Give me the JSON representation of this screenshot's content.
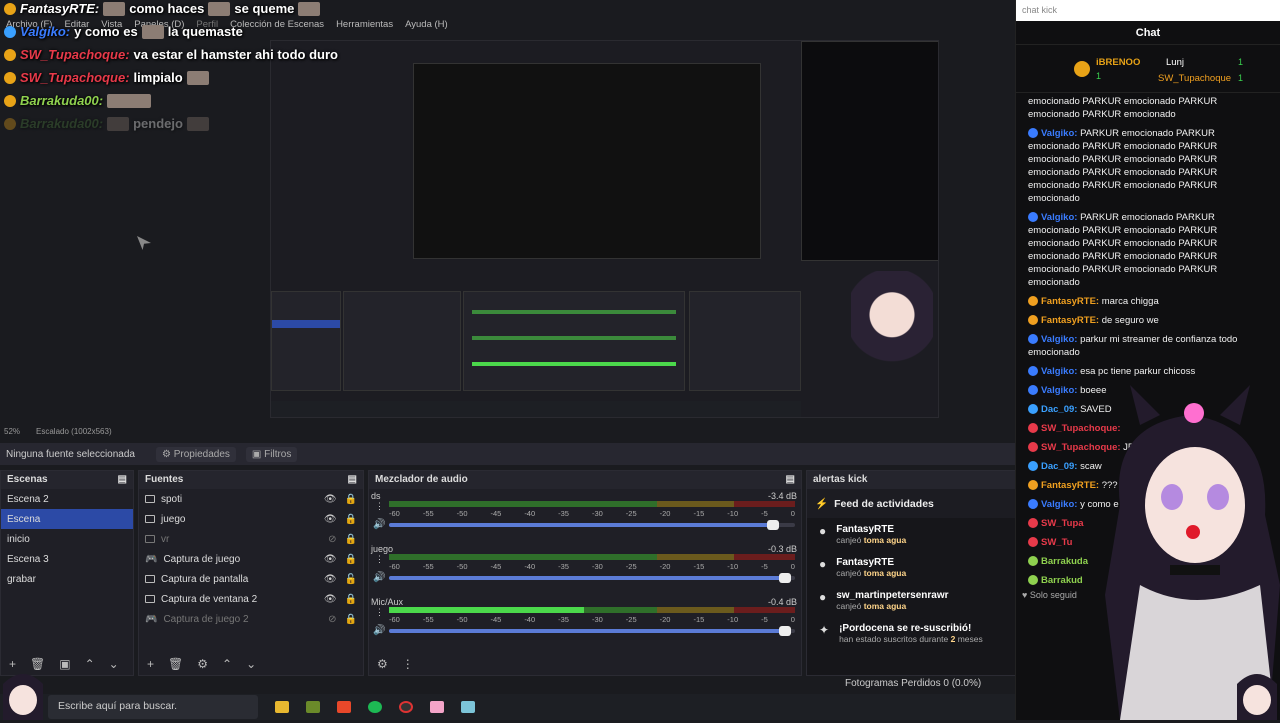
{
  "overlay_chat": {
    "lines": [
      {
        "user": "FantasyRTE:",
        "user_color": "#ffffff",
        "text_parts": [
          "como haces",
          "se queme"
        ]
      },
      {
        "user": "Valgiko:",
        "user_color": "#3a7cff",
        "text_parts": [
          "y como es",
          "la quemaste"
        ]
      },
      {
        "user": "SW_Tupachoque:",
        "user_color": "#e83a4a",
        "text_parts": [
          "va estar el hamster ahi todo duro"
        ]
      },
      {
        "user": "SW_Tupachoque:",
        "user_color": "#e83a4a",
        "text_parts": [
          "limpialo"
        ]
      },
      {
        "user": "Barrakuda00:",
        "user_color": "#8fd14f",
        "text_parts": [
          ""
        ]
      },
      {
        "user": "Barrakuda00:",
        "user_color": "#4a7a3a",
        "text_parts": [
          "pendejo"
        ]
      }
    ]
  },
  "menubar": [
    "Archivo (F)",
    "Editar",
    "Vista",
    "Paneles (D)",
    "Perfil",
    "Colección de Escenas",
    "Herramientas",
    "Ayuda (H)"
  ],
  "preview_status": {
    "zoom": "52%",
    "scaled": "Escalado (1002x563)"
  },
  "source_toolbar": {
    "no_source": "Ninguna fuente seleccionada",
    "properties": "Propiedades",
    "filters": "Filtros"
  },
  "scenes": {
    "title": "Escenas",
    "items": [
      "Escena 2",
      "Escena",
      "inicio",
      "Escena 3",
      "grabar"
    ],
    "active_index": 1
  },
  "sources": {
    "title": "Fuentes",
    "items": [
      "spoti",
      "juego",
      "vr",
      "Captura de juego",
      "Captura de pantalla",
      "Captura de ventana 2",
      "Captura de juego 2"
    ]
  },
  "mixer": {
    "title": "Mezclador de audio",
    "channels": [
      {
        "name": "ds",
        "db": "-3.4 dB",
        "level": 0.0,
        "volume": 0.96
      },
      {
        "name": "juego",
        "db": "-0.3 dB",
        "level": 0.0,
        "volume": 0.99
      },
      {
        "name": "Mic/Aux",
        "db": "-0.4 dB",
        "level": 0.48,
        "volume": 0.99
      }
    ],
    "scale": [
      "-60",
      "-55",
      "-50",
      "-45",
      "-40",
      "-35",
      "-30",
      "-25",
      "-20",
      "-15",
      "-10",
      "-5",
      "0"
    ]
  },
  "alerts": {
    "title": "alertas kick",
    "feed_title": "Feed de actividades",
    "items": [
      {
        "name": "FantasyRTE",
        "sub_prefix": "canjeó",
        "sub_bold": "toma agua"
      },
      {
        "name": "FantasyRTE",
        "sub_prefix": "canjeó",
        "sub_bold": "toma agua"
      },
      {
        "name": "sw_martinpetersenrawr",
        "sub_prefix": "canjeó",
        "sub_bold": "toma agua"
      },
      {
        "name": "¡Pordocena se re-suscribió!",
        "sub_prefix": "han estado suscritos durante",
        "sub_bold": "2",
        "sub_suffix": "meses"
      }
    ]
  },
  "statusbar": {
    "frames_lost": "Fotogramas Perdidos 0 (0.0%)"
  },
  "taskbar": {
    "search_placeholder": "Escribe aquí para buscar."
  },
  "chat": {
    "search_placeholder": "chat kick",
    "title": "Chat",
    "leaderboard": [
      {
        "name": "iBRENOO",
        "count": "1"
      },
      {
        "name": "Lunj",
        "count": "1"
      },
      {
        "name": "SW_Tupachoque",
        "count": "1"
      }
    ],
    "messages": [
      {
        "user": "",
        "color": "#ffffff",
        "text": "emocionado PARKUR emocionado PARKUR emocionado PARKUR emocionado"
      },
      {
        "user": "Valgiko:",
        "color": "#3a7cff",
        "text": "PARKUR emocionado PARKUR emocionado PARKUR emocionado PARKUR emocionado PARKUR emocionado PARKUR emocionado PARKUR emocionado PARKUR emocionado PARKUR emocionado PARKUR emocionado"
      },
      {
        "user": "Valgiko:",
        "color": "#3a7cff",
        "text": "PARKUR emocionado PARKUR emocionado PARKUR emocionado PARKUR emocionado PARKUR emocionado PARKUR emocionado PARKUR emocionado PARKUR emocionado PARKUR emocionado PARKUR emocionado"
      },
      {
        "user": "FantasyRTE:",
        "color": "#f0a020",
        "text": "marca chigga"
      },
      {
        "user": "FantasyRTE:",
        "color": "#f0a020",
        "text": "de seguro we"
      },
      {
        "user": "Valgiko:",
        "color": "#3a7cff",
        "text": "parkur mi streamer de confianza todo emocionado"
      },
      {
        "user": "Valgiko:",
        "color": "#3a7cff",
        "text": "esa pc tiene parkur chicoss"
      },
      {
        "user": "Valgiko:",
        "color": "#3a7cff",
        "text": "boeee"
      },
      {
        "user": "Dac_09:",
        "color": "#3aa0ff",
        "text": "SAVED"
      },
      {
        "user": "SW_Tupachoque:",
        "color": "#e83a4a",
        "text": ""
      },
      {
        "user": "SW_Tupachoque:",
        "color": "#e83a4a",
        "text": "JE"
      },
      {
        "user": "Dac_09:",
        "color": "#3aa0ff",
        "text": "scaw"
      },
      {
        "user": "FantasyRTE:",
        "color": "#f0a020",
        "text": "??? c"
      },
      {
        "user": "Valgiko:",
        "color": "#3a7cff",
        "text": "y como e"
      },
      {
        "user": "SW_Tupa",
        "color": "#e83a4a",
        "text": ""
      },
      {
        "user": "SW_Tu",
        "color": "#e83a4a",
        "text": ""
      },
      {
        "user": "Barrakuda",
        "color": "#8fd14f",
        "text": ""
      },
      {
        "user": "Barrakud",
        "color": "#8fd14f",
        "text": ""
      }
    ],
    "followers_only": "Solo seguid"
  }
}
